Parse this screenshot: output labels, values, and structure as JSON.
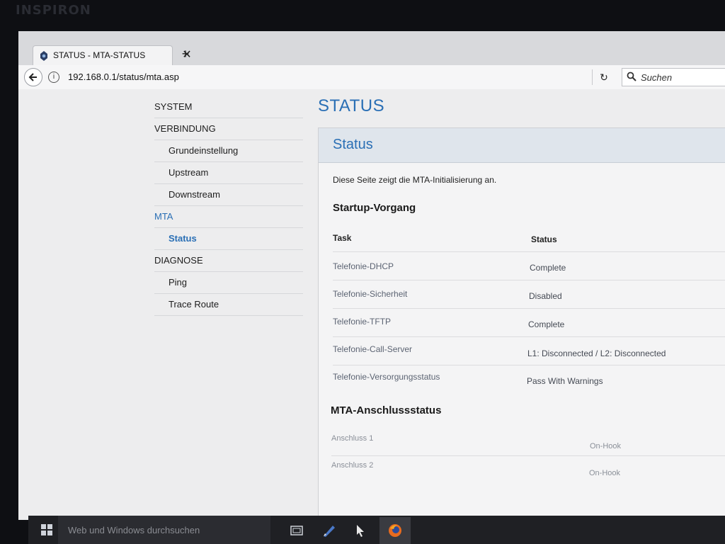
{
  "bezel": {
    "brand": "INSPIRON"
  },
  "browser": {
    "tab_title": "STATUS - MTA-STATUS",
    "tab_close": "✕",
    "new_tab": "+",
    "url": "192.168.0.1/status/mta.asp",
    "info_glyph": "i",
    "reload_glyph": "↻",
    "search_placeholder": "Suchen"
  },
  "sidebar": {
    "items": [
      {
        "label": "SYSTEM"
      },
      {
        "label": "VERBINDUNG"
      },
      {
        "label": "Grundeinstellung"
      },
      {
        "label": "Upstream"
      },
      {
        "label": "Downstream"
      },
      {
        "label": "MTA"
      },
      {
        "label": "Status"
      },
      {
        "label": "DIAGNOSE"
      },
      {
        "label": "Ping"
      },
      {
        "label": "Trace Route"
      }
    ]
  },
  "main": {
    "page_title": "STATUS",
    "panel_title": "Status",
    "description": "Diese Seite zeigt die MTA-Initialisierung an.",
    "startup_title": "Startup-Vorgang",
    "col_task": "Task",
    "col_status": "Status",
    "startup_rows": [
      {
        "task": "Telefonie-DHCP",
        "status": "Complete"
      },
      {
        "task": "Telefonie-Sicherheit",
        "status": "Disabled"
      },
      {
        "task": "Telefonie-TFTP",
        "status": "Complete"
      },
      {
        "task": "Telefonie-Call-Server",
        "status": "L1: Disconnected / L2: Disconnected"
      },
      {
        "task": "Telefonie-Versorgungsstatus",
        "status": "Pass With Warnings"
      }
    ],
    "ports_title": "MTA-Anschlussstatus",
    "port_rows": [
      {
        "port": "Anschluss 1",
        "status": "On-Hook"
      },
      {
        "port": "Anschluss 2",
        "status": "On-Hook"
      }
    ]
  },
  "taskbar": {
    "search_placeholder": "Web und Windows durchsuchen"
  },
  "colors": {
    "accent": "#2a6fb5"
  }
}
